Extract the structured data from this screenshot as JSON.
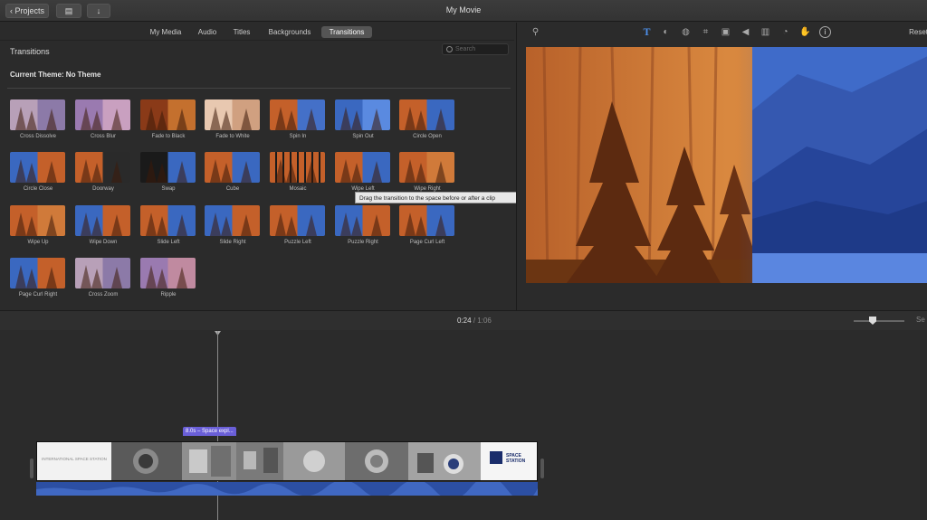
{
  "titlebar": {
    "projects_label": "Projects",
    "window_title": "My Movie"
  },
  "browser": {
    "tabs": [
      {
        "label": "My Media"
      },
      {
        "label": "Audio"
      },
      {
        "label": "Titles"
      },
      {
        "label": "Backgrounds"
      },
      {
        "label": "Transitions",
        "active": true
      }
    ],
    "panel_title": "Transitions",
    "search_placeholder": "Search",
    "current_theme": "Current Theme: No Theme",
    "tooltip": "Drag the transition to the space before or after a clip",
    "transitions": [
      "Cross Dissolve",
      "Cross Blur",
      "Fade to Black",
      "Fade to White",
      "Spin In",
      "Spin Out",
      "Circle Open",
      "Circle Close",
      "Doorway",
      "Swap",
      "Cube",
      "Mosaic",
      "Wipe Left",
      "Wipe Right",
      "Wipe Up",
      "Wipe Down",
      "Slide Left",
      "Slide Right",
      "Puzzle Left",
      "Puzzle Right",
      "Page Curl Left",
      "Page Curl Right",
      "Cross Zoom",
      "Ripple"
    ]
  },
  "viewer": {
    "reset_label": "Reset",
    "tool_icons": [
      "magic-wand-icon",
      "title-icon",
      "color-balance-icon",
      "color-correction-icon",
      "crop-icon",
      "stabilization-icon",
      "volume-icon",
      "equalizer-icon",
      "speed-icon",
      "noise-reduction-icon",
      "info-icon"
    ]
  },
  "timebar": {
    "current": "0:24",
    "separator": "/",
    "total": "1:06",
    "settings_label": "Se"
  },
  "timeline": {
    "clip_label": "8.0s – Space expl...",
    "title_card_text": "INTERNATIONAL SPACE STATION",
    "end_card_text": "SPACE STATION"
  },
  "colors": {
    "accent": "#6a5fd8",
    "audio": "#2c4fa3",
    "tab_active": "#555555"
  }
}
